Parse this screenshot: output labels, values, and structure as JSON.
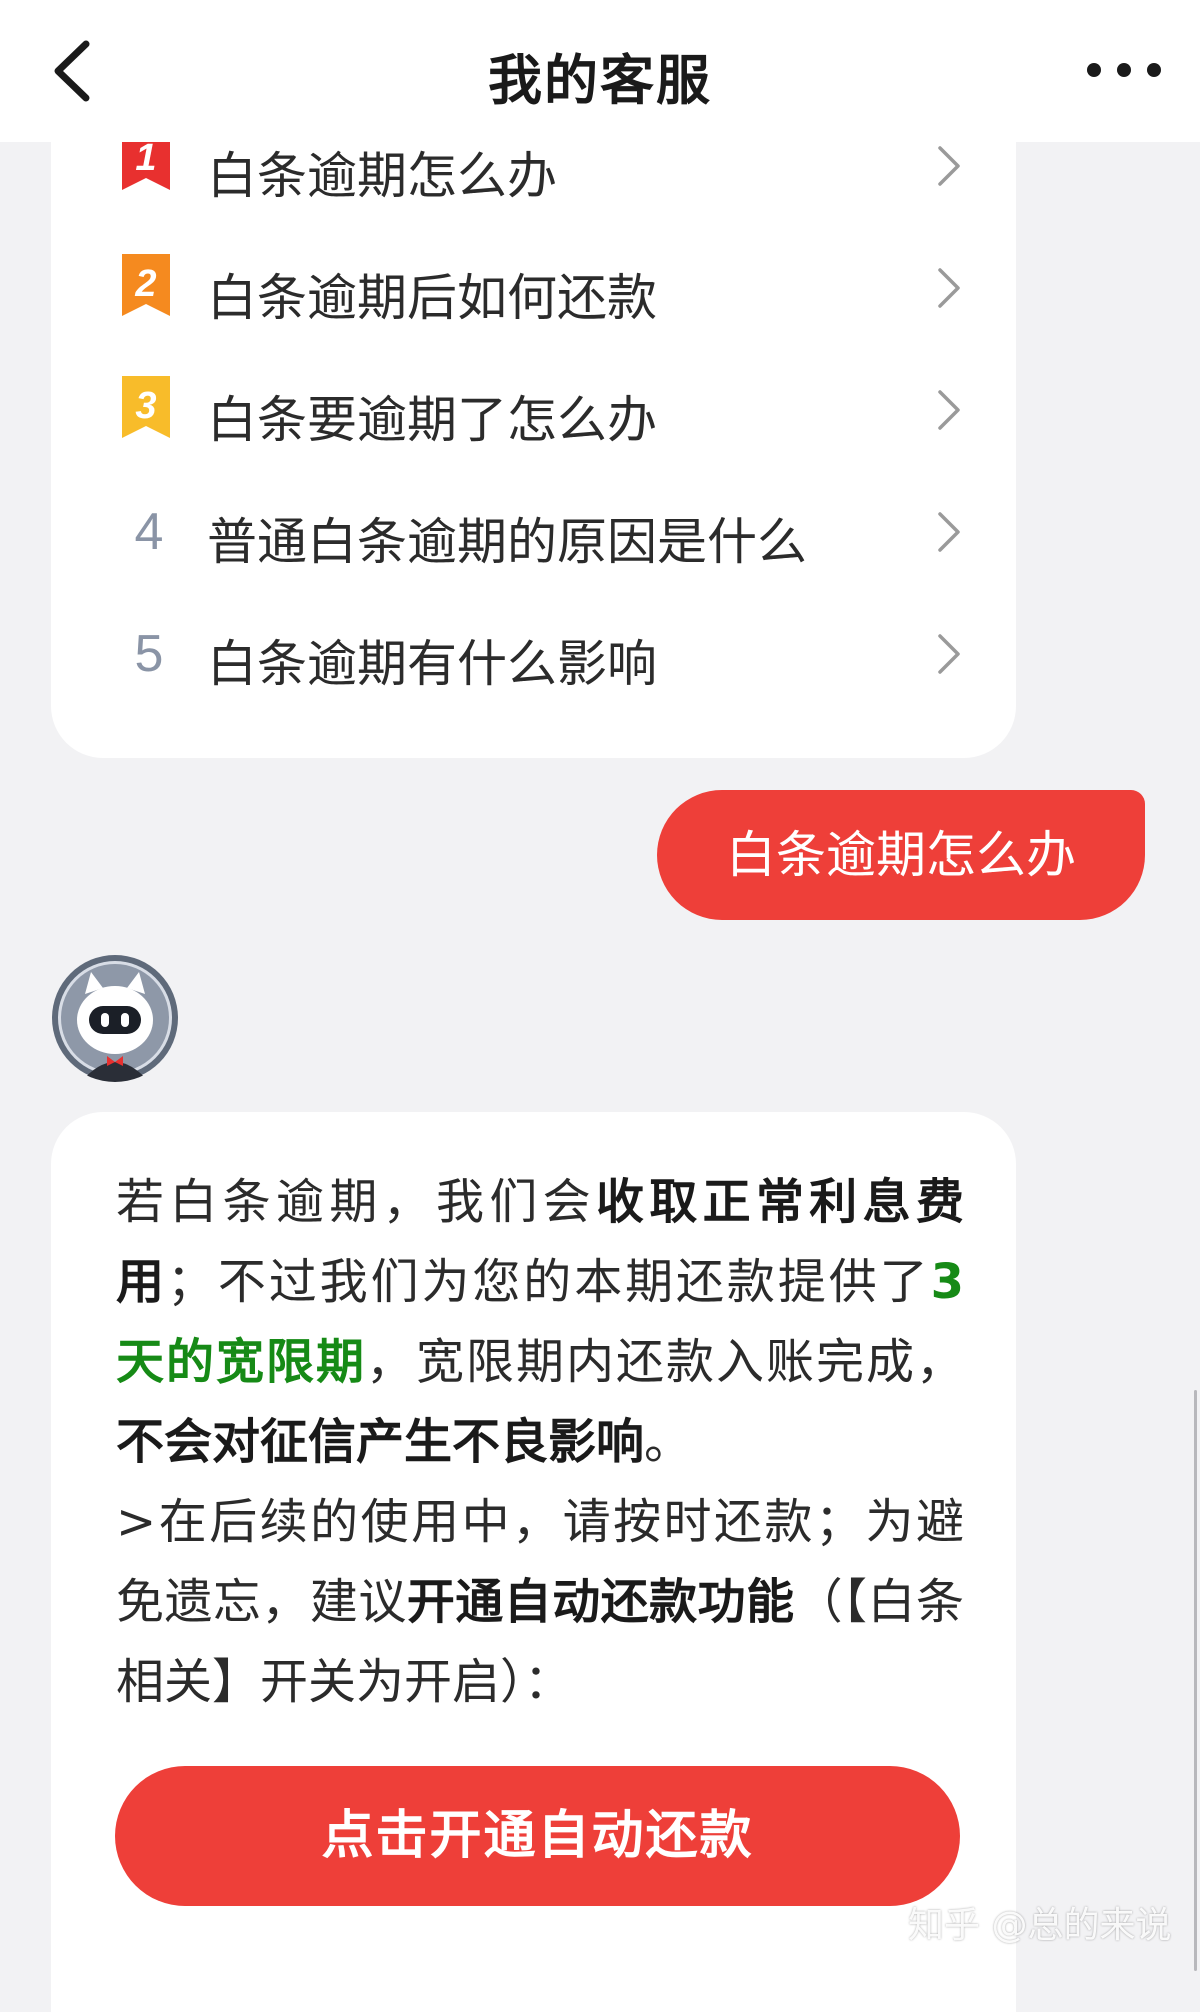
{
  "header": {
    "title": "我的客服",
    "back_icon": "chevron-left-icon",
    "more_icon": "more-dots-icon"
  },
  "faq": {
    "items": [
      {
        "rank": "1",
        "label": "白条逾期怎么办",
        "badge_color": "#e8302f"
      },
      {
        "rank": "2",
        "label": "白条逾期后如何还款",
        "badge_color": "#f58a1f"
      },
      {
        "rank": "3",
        "label": "白条要逾期了怎么办",
        "badge_color": "#f8bc2a"
      },
      {
        "rank": "4",
        "label": "普通白条逾期的原因是什么"
      },
      {
        "rank": "5",
        "label": "白条逾期有什么影响"
      }
    ]
  },
  "chat": {
    "user_message": "白条逾期怎么办",
    "bot_avatar": "robot-avatar-icon",
    "answer": {
      "p1_a": "若白条逾期，我们会",
      "p1_b": "收取正常利息费用",
      "p1_c": "；不过我们为您的本期还款提供了",
      "p1_d": "3天的宽限期",
      "p1_e": "，宽限期内还款入账完成，",
      "p1_f": "不会对征信产生不良影响",
      "p1_g": "。",
      "p2_a": ">在后续的使用中，请按时还款；为避免遗忘，建议",
      "p2_b": "开通自动还款功能",
      "p2_c": "（【白条相关】开关为开启）："
    },
    "cta_label": "点击开通自动还款"
  },
  "watermark": "知乎 @总的来说",
  "colors": {
    "accent_red": "#ee3f39",
    "highlight_green": "#168a16",
    "background": "#f2f2f4"
  }
}
